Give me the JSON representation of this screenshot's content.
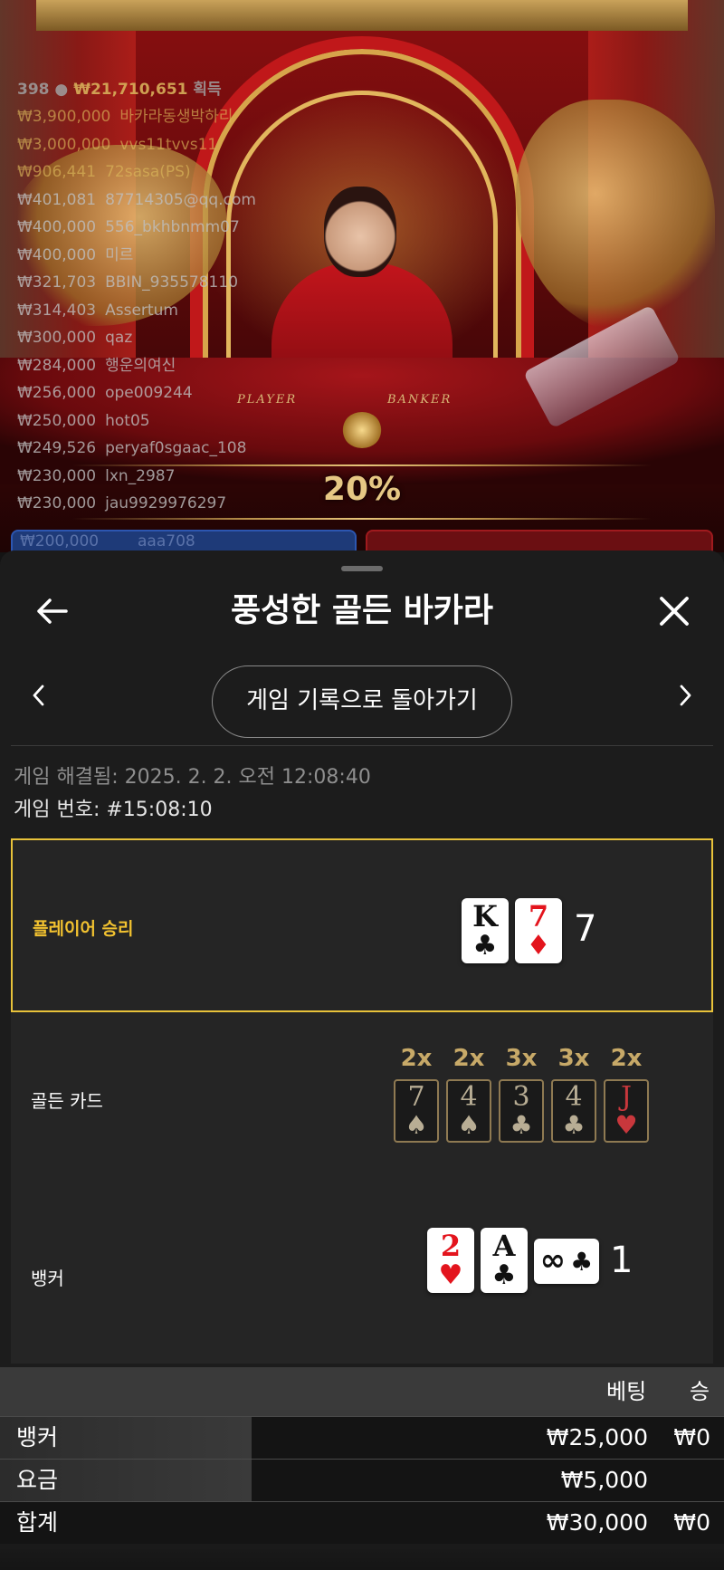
{
  "video": {
    "player_label": "PLAYER",
    "banker_label": "BANKER",
    "multiplier": "20%"
  },
  "winners": {
    "count": "398",
    "total": "₩21,710,651",
    "suffix": "획득",
    "rows": [
      {
        "amount": "₩3,900,000",
        "name": "바카라동생박하리"
      },
      {
        "amount": "₩3,000,000",
        "name": "vvs11tvvs11"
      },
      {
        "amount": "₩906,441",
        "name": "72sasa(PS)"
      },
      {
        "amount": "₩401,081",
        "name": "87714305@qq.com"
      },
      {
        "amount": "₩400,000",
        "name": "556_bkhbnmm07"
      },
      {
        "amount": "₩400,000",
        "name": "미르"
      },
      {
        "amount": "₩321,703",
        "name": "BBIN_935578110"
      },
      {
        "amount": "₩314,403",
        "name": "Assertum"
      },
      {
        "amount": "₩300,000",
        "name": "qaz"
      },
      {
        "amount": "₩284,000",
        "name": "행운의여신"
      },
      {
        "amount": "₩256,000",
        "name": "ope009244"
      },
      {
        "amount": "₩250,000",
        "name": "hot05"
      },
      {
        "amount": "₩249,526",
        "name": "peryaf0sgaac_108"
      },
      {
        "amount": "₩230,000",
        "name": "lxn_2987"
      },
      {
        "amount": "₩230,000",
        "name": "jau9929976297"
      },
      {
        "amount": "₩200,000",
        "name": "aaa708"
      }
    ]
  },
  "sheet": {
    "title": "풍성한 골든 바카라",
    "back_to_history": "게임 기록으로 돌아가기",
    "resolved": "게임 해결됨: 2025. 2. 2. 오전 12:08:40",
    "game_number": "게임 번호: #15:08:10"
  },
  "icons": {
    "back": "arrow-left-icon",
    "close": "close-icon",
    "prev": "chevron-left-icon",
    "next": "chevron-right-icon"
  },
  "results": {
    "player": {
      "label": "플레이어 승리",
      "cards": [
        {
          "rank": "K",
          "suit": "♣",
          "color": "black"
        },
        {
          "rank": "7",
          "suit": "♦",
          "color": "red"
        }
      ],
      "score": "7"
    },
    "golden": {
      "label": "골든 카드",
      "cards": [
        {
          "mult": "2x",
          "rank": "7",
          "suit": "♠",
          "color": "dark"
        },
        {
          "mult": "2x",
          "rank": "4",
          "suit": "♠",
          "color": "dark"
        },
        {
          "mult": "3x",
          "rank": "3",
          "suit": "♣",
          "color": "dark"
        },
        {
          "mult": "3x",
          "rank": "4",
          "suit": "♣",
          "color": "dark"
        },
        {
          "mult": "2x",
          "rank": "J",
          "suit": "♥",
          "color": "red"
        }
      ]
    },
    "banker": {
      "label": "뱅커",
      "cards": [
        {
          "rank": "2",
          "suit": "♥",
          "color": "red"
        },
        {
          "rank": "A",
          "suit": "♣",
          "color": "black"
        }
      ],
      "infinity_card": {
        "rank": "∞",
        "suit": "♣"
      },
      "score": "1"
    }
  },
  "bets": {
    "headers": {
      "bet": "베팅",
      "win": "승"
    },
    "rows": [
      {
        "name": "뱅커",
        "bet": "₩25,000",
        "win": "₩0"
      },
      {
        "name": "요금",
        "bet": "₩5,000",
        "win": ""
      }
    ],
    "total": {
      "name": "합계",
      "bet": "₩30,000",
      "win": "₩0"
    }
  }
}
